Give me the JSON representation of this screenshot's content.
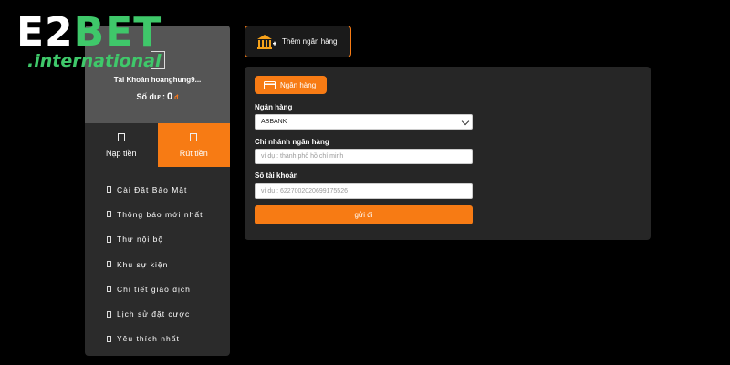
{
  "logo": {
    "main_left": "E2",
    "main_right": "BET",
    "sub": ".international"
  },
  "account": {
    "name": "Tài Khoản hoanghung9...",
    "balance_label": "Số dư :",
    "balance_value": "0",
    "currency_symbol": "đ"
  },
  "tabs": {
    "deposit": "Nạp tiền",
    "withdraw": "Rút tiền"
  },
  "menu": [
    "Cài Đặt Bảo Mật",
    "Thông báo mới nhất",
    "Thư nội bộ",
    "Khu sự kiện",
    "Chi tiết giao dịch",
    "Lịch sử đặt cược",
    "Yêu thích nhất"
  ],
  "add_bank_label": "Thêm ngân hàng",
  "form": {
    "tab_label": "Ngân hàng",
    "bank_label": "Ngân hàng",
    "bank_value": "ABBANK",
    "branch_label": "Chi nhánh ngân hàng",
    "branch_placeholder": "ví dụ : thành phố hồ chí minh",
    "account_label": "Số tài khoản",
    "account_placeholder": "ví dụ : 6227002020699175526",
    "submit_label": "gửi đi"
  },
  "colors": {
    "accent": "#f77b14",
    "brand_green": "#3fc86a",
    "background": "#000000"
  }
}
